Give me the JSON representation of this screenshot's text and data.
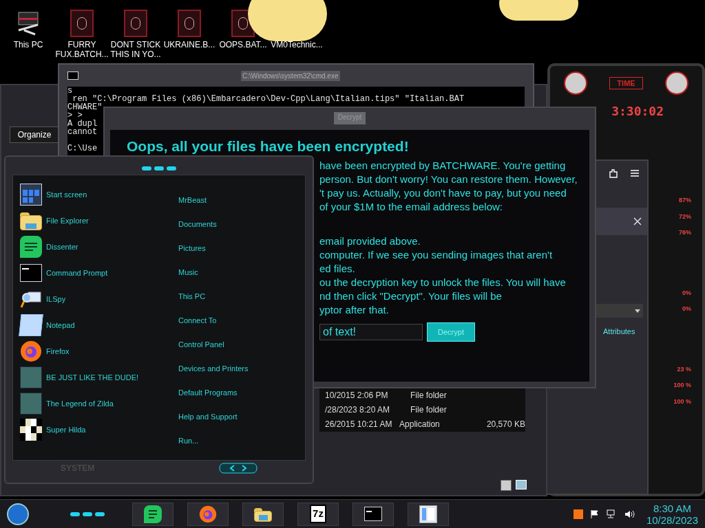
{
  "desktop_icons": [
    {
      "label": "This PC",
      "kind": "computer"
    },
    {
      "label": "FURRY FUX.BATCH...",
      "kind": "batch"
    },
    {
      "label": "DONT STICK THIS IN YO...",
      "kind": "batch"
    },
    {
      "label": "UKRAINE.B...",
      "kind": "batch"
    },
    {
      "label": "OOPS.BAT...",
      "kind": "batch"
    },
    {
      "label": "VM0Technic...",
      "kind": "none"
    }
  ],
  "cmd_window": {
    "title": "C:\\Windows\\system32\\cmd.exe",
    "lines": [
      "s",
      " ren \"C:\\Program Files (x86)\\Embarcadero\\Dev-Cpp\\Lang\\Italian.tips\" \"Italian.BAT",
      "CHWARE\"",
      "> >",
      "A dupl",
      "cannot"
    ],
    "prompt": "C:\\Use"
  },
  "explorer": {
    "toolbar_button": "Organize",
    "rows": [
      {
        "modified": "10/2015 2:06 PM",
        "type": "File folder"
      },
      {
        "modified": "/28/2023 8:20 AM",
        "type": "File folder"
      },
      {
        "modified": "26/2015 10:21 AM",
        "type": "Application",
        "size": "20,570 KB"
      }
    ]
  },
  "side_window": {
    "column": "Attributes"
  },
  "decrypt_window": {
    "title": "Decrypt",
    "heading": "Oops, all your files have been encrypted!",
    "paragraph_1": [
      "have been encrypted by BATCHWARE. You're getting",
      "person. But don't worry! You can restore them. However,",
      "'t pay us. Actually, you don't have to pay, but you need",
      "of your $1M to the email address below:"
    ],
    "paragraph_2": [
      "email provided above.",
      "computer. If we see you sending images that aren't",
      "ed files.",
      "ou the decryption key to unlock the files. You will have",
      "nd then click \"Decrypt\". Your files will be",
      "yptor after that."
    ],
    "input_value": "of text!",
    "button": "Decrypt"
  },
  "start_menu": {
    "programs": [
      "Start screen",
      "File Explorer",
      "Dissenter",
      "Command Prompt",
      "ILSpy",
      "Notepad",
      "Firefox",
      "BE JUST LIKE THE DUDE!",
      "The Legend of Zilda",
      "Super Hilda"
    ],
    "places": [
      "MrBeast",
      "Documents",
      "Pictures",
      "Music",
      "This PC",
      "Connect To",
      "Control Panel",
      "Devices and Printers",
      "Default Programs",
      "Help and Support",
      "Run..."
    ],
    "footer": "SYSTEM"
  },
  "gadget": {
    "title": "TIME",
    "time": "3:30:02",
    "readings": [
      "87%",
      "72%",
      "76%",
      "0%",
      "0%",
      "23 %",
      "100 %",
      "100 %"
    ]
  },
  "taskbar": {
    "apps": [
      {
        "kind": "chat"
      },
      {
        "kind": "firefox"
      },
      {
        "kind": "folder"
      },
      {
        "kind": "archive",
        "label": "7z"
      },
      {
        "kind": "console"
      },
      {
        "kind": "window"
      }
    ],
    "tray": [
      {
        "kind": "java"
      },
      {
        "kind": "flag"
      },
      {
        "kind": "network"
      },
      {
        "kind": "volume"
      }
    ],
    "clock_time": "8:30 AM",
    "clock_date": "10/28/2023"
  }
}
